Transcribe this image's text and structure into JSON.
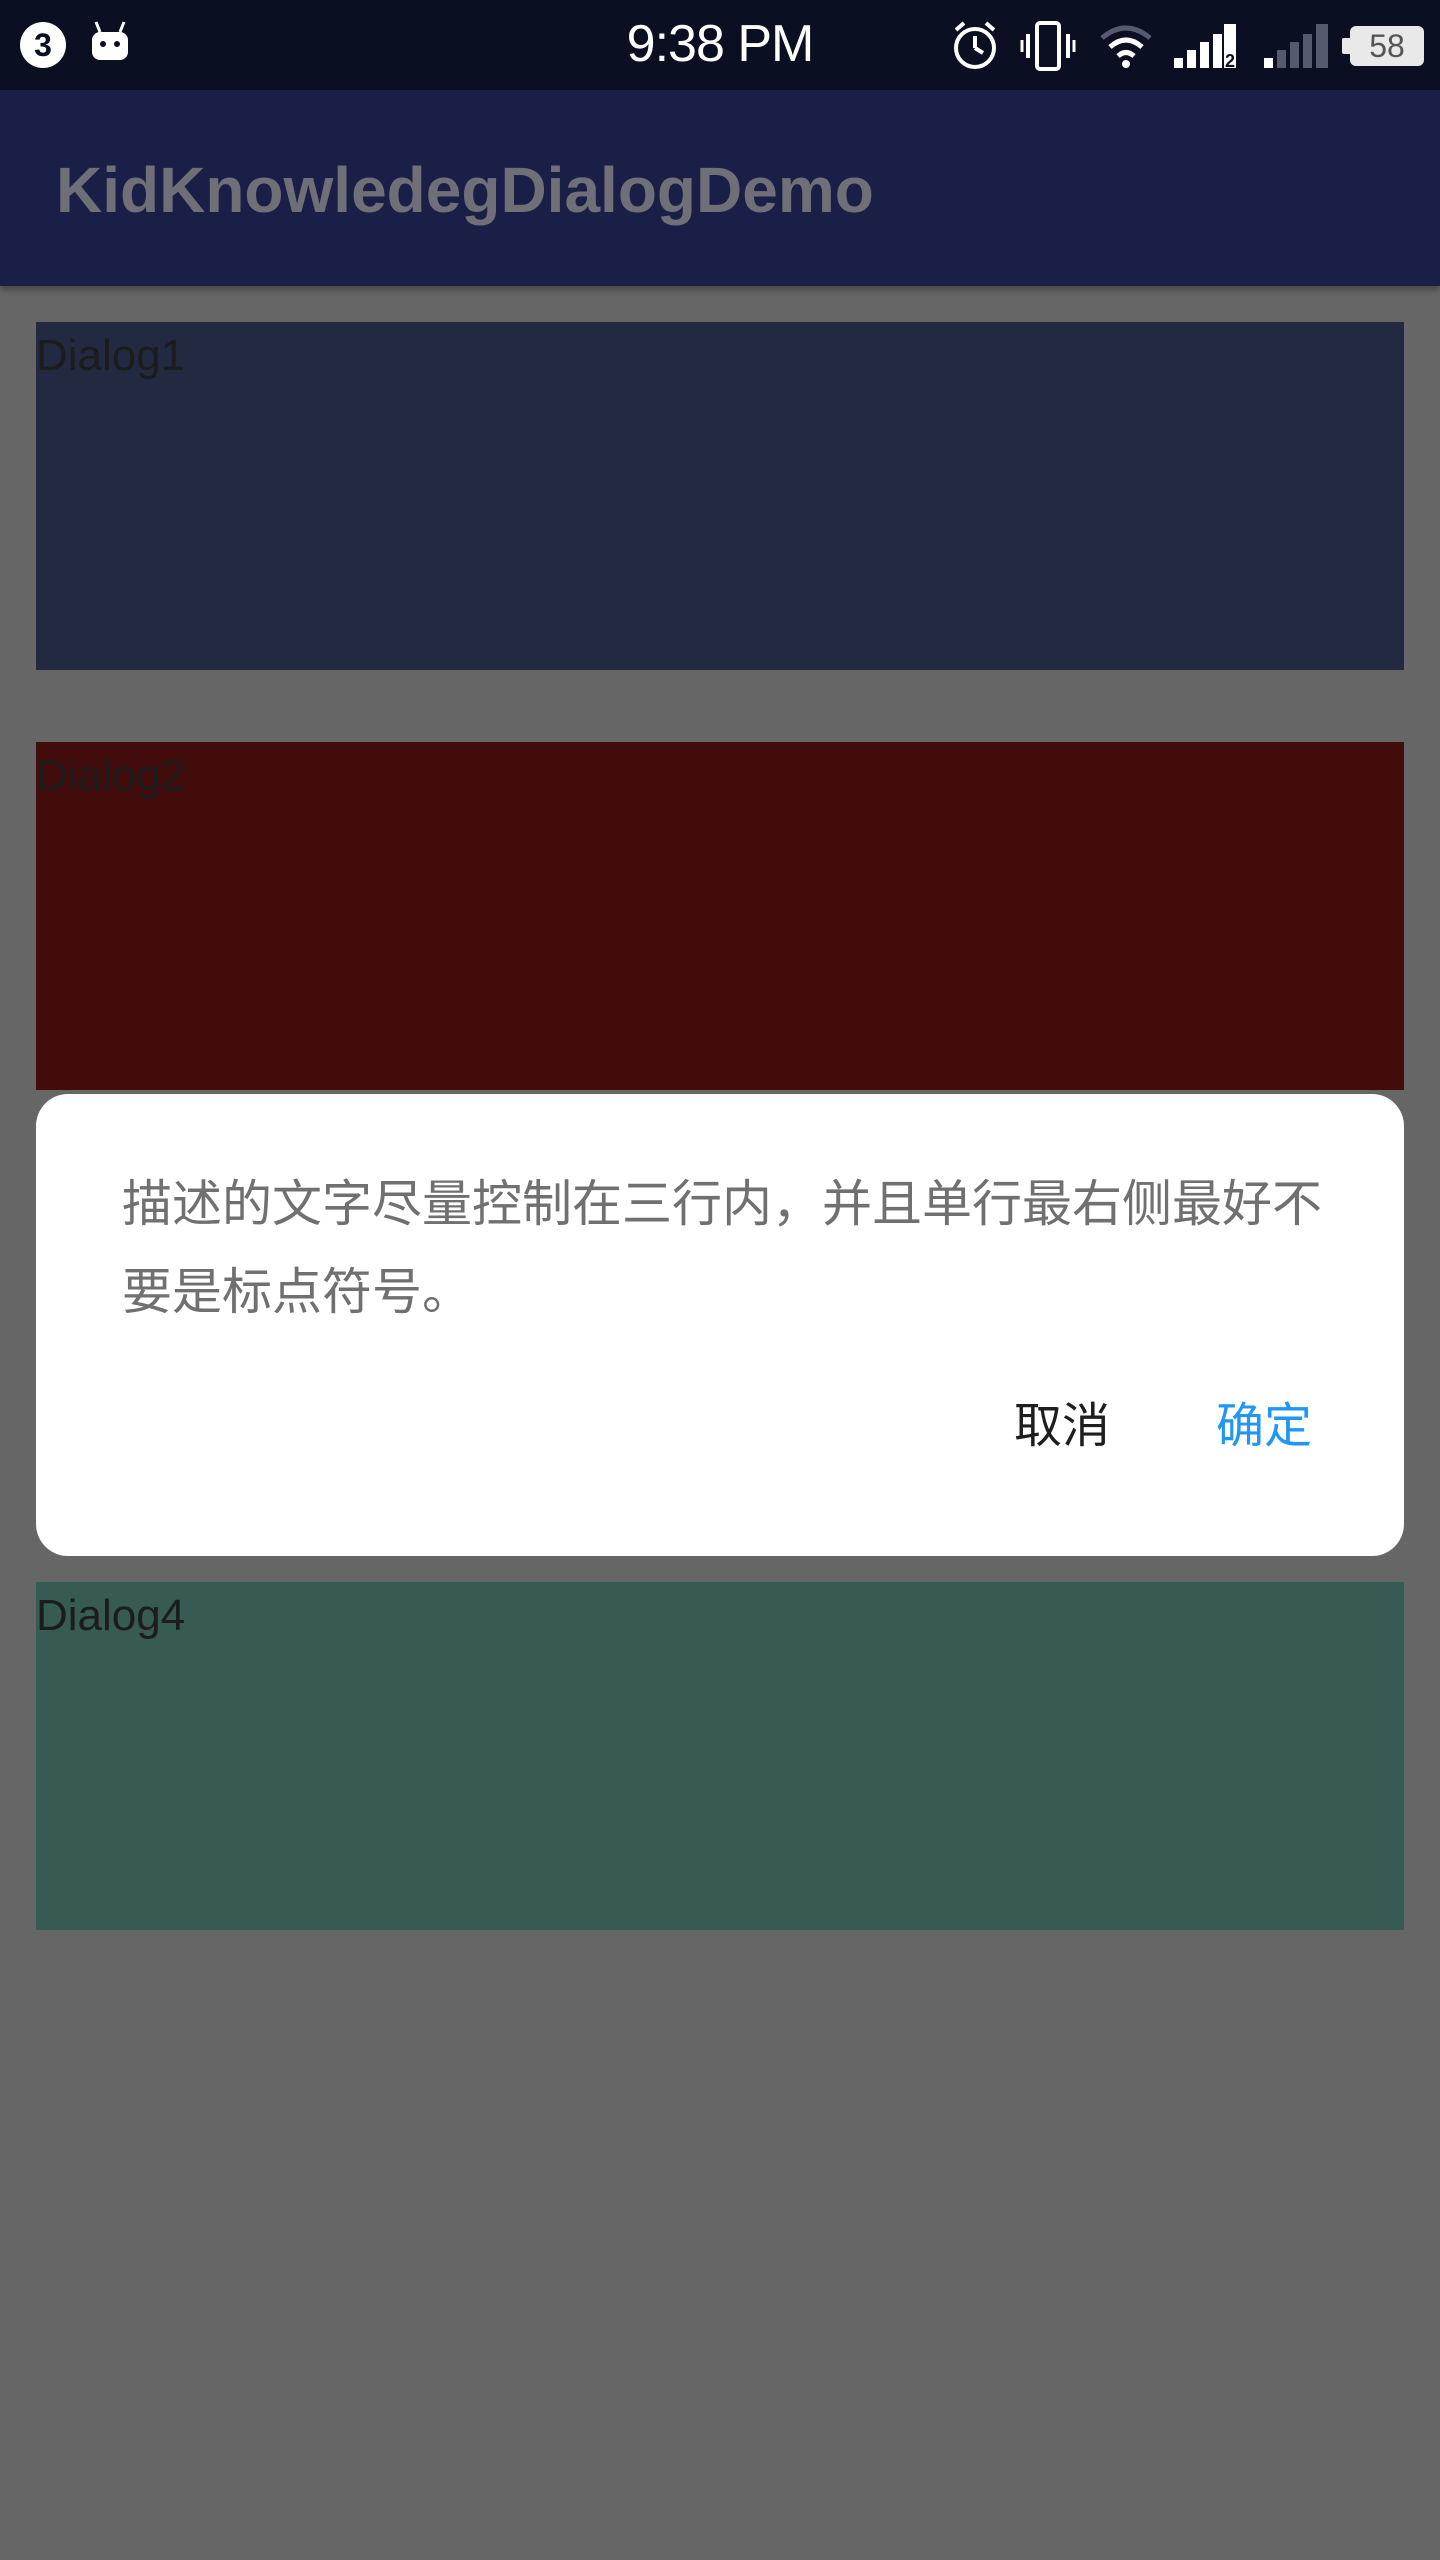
{
  "status_bar": {
    "notification_count": "3",
    "time": "9:38 PM",
    "battery": "58",
    "icons": [
      "android-icon",
      "alarm-icon",
      "vibrate-icon",
      "wifi-icon",
      "signal-icon",
      "signal-2-icon",
      "battery-icon"
    ]
  },
  "app_bar": {
    "title": "KidKnowledegDialogDemo",
    "background": "#1a1f48"
  },
  "blocks": [
    {
      "label": "Dialog1",
      "color": "#222a41"
    },
    {
      "label": "Dialog2",
      "color": "#420c0d"
    },
    {
      "label": "Dialog4",
      "color": "#375a52"
    }
  ],
  "dialog": {
    "message": "描述的文字尽量控制在三行内，并且单行最右侧最好不要是标点符号。",
    "cancel_label": "取消",
    "confirm_label": "确定",
    "confirm_color": "#2196f3"
  },
  "scrim_color": "#666666"
}
